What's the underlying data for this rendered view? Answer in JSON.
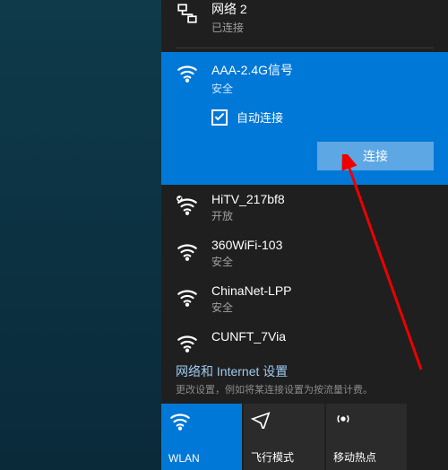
{
  "connected": {
    "name": "网络 2",
    "status": "已连接"
  },
  "selected": {
    "name": "AAA-2.4G信号",
    "security": "安全",
    "auto_connect_label": "自动连接",
    "connect_button": "连接"
  },
  "networks": [
    {
      "name": "HiTV_217bf8",
      "security": "开放",
      "secured": false
    },
    {
      "name": "360WiFi-103",
      "security": "安全",
      "secured": true
    },
    {
      "name": "ChinaNet-LPP",
      "security": "安全",
      "secured": true
    },
    {
      "name": "CUNFT_7Via",
      "security": "",
      "secured": true
    }
  ],
  "settings": {
    "title": "网络和 Internet 设置",
    "subtitle": "更改设置，例如将某连接设置为按流量计费。"
  },
  "quick": [
    {
      "label": "WLAN",
      "icon": "wifi",
      "active": true
    },
    {
      "label": "飞行模式",
      "icon": "airplane",
      "active": false
    },
    {
      "label": "移动热点",
      "icon": "hotspot",
      "active": false
    }
  ]
}
